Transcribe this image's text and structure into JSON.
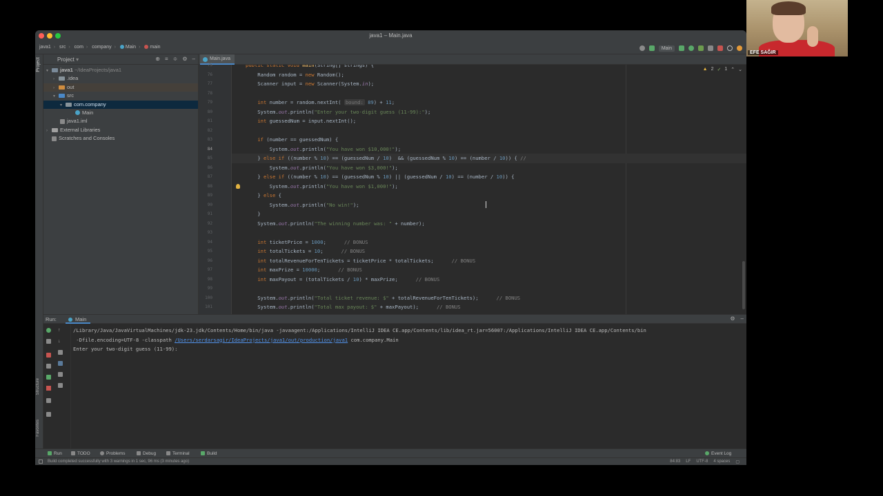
{
  "window": {
    "title": "java1 – Main.java"
  },
  "breadcrumb": [
    "java1",
    "src",
    "com",
    "company",
    "Main",
    "main"
  ],
  "toolbar": {
    "run_config": "Main"
  },
  "project_panel": {
    "title": "Project",
    "tree": [
      {
        "label": "java1",
        "suffix": " ~/IdeaProjects/java1",
        "depth": 0,
        "type": "project"
      },
      {
        "label": ".idea",
        "depth": 1,
        "type": "folder"
      },
      {
        "label": "out",
        "depth": 1,
        "type": "folder-excluded"
      },
      {
        "label": "src",
        "depth": 1,
        "type": "folder-src"
      },
      {
        "label": "com.company",
        "depth": 2,
        "type": "package"
      },
      {
        "label": "Main",
        "depth": 3,
        "type": "class"
      },
      {
        "label": "java1.iml",
        "depth": 1,
        "type": "file"
      },
      {
        "label": "External Libraries",
        "depth": 0,
        "type": "lib"
      },
      {
        "label": "Scratches and Consoles",
        "depth": 0,
        "type": "scratch"
      }
    ]
  },
  "editor": {
    "tab": "Main.java",
    "inspections": {
      "warnings": "2",
      "weak_warnings": "1"
    },
    "first_line": 75,
    "current_line": 84
  },
  "run_window": {
    "label": "Run:",
    "tab": "Main",
    "console": {
      "line1": "/Library/Java/JavaVirtualMachines/jdk-23.jdk/Contents/Home/bin/java -javaagent:/Applications/IntelliJ IDEA CE.app/Contents/lib/idea_rt.jar=56007:/Applications/IntelliJ IDEA CE.app/Contents/bin",
      "line2_pre": " -Dfile.encoding=UTF-8 -classpath ",
      "line2_link": "/Users/serdarsagir/IdeaProjects/java1/out/production/java1",
      "line2_post": " com.company.Main",
      "line3": "Enter your two-digit guess (11-99): "
    }
  },
  "left_stripe": {
    "structure": "Structure",
    "favorites": "Favorites"
  },
  "bottom_tools": {
    "run": "Run",
    "todo": "TODO",
    "problems": "Problems",
    "debug": "Debug",
    "terminal": "Terminal",
    "build": "Build",
    "event_log": "Event Log"
  },
  "status": {
    "message": "Build completed successfully with 3 warnings in 1 sec, 96 ms (3 minutes ago)",
    "position": "84:83",
    "line_sep": "LF",
    "encoding": "UTF-8",
    "indent": "4 spaces"
  },
  "webcam": {
    "name": "EFE SAĞIR"
  },
  "colors": {
    "keyword": "#cc7832",
    "string": "#6a8759",
    "number": "#6897bb",
    "field": "#9876aa",
    "comment": "#808080",
    "selection": "#0d293e"
  }
}
